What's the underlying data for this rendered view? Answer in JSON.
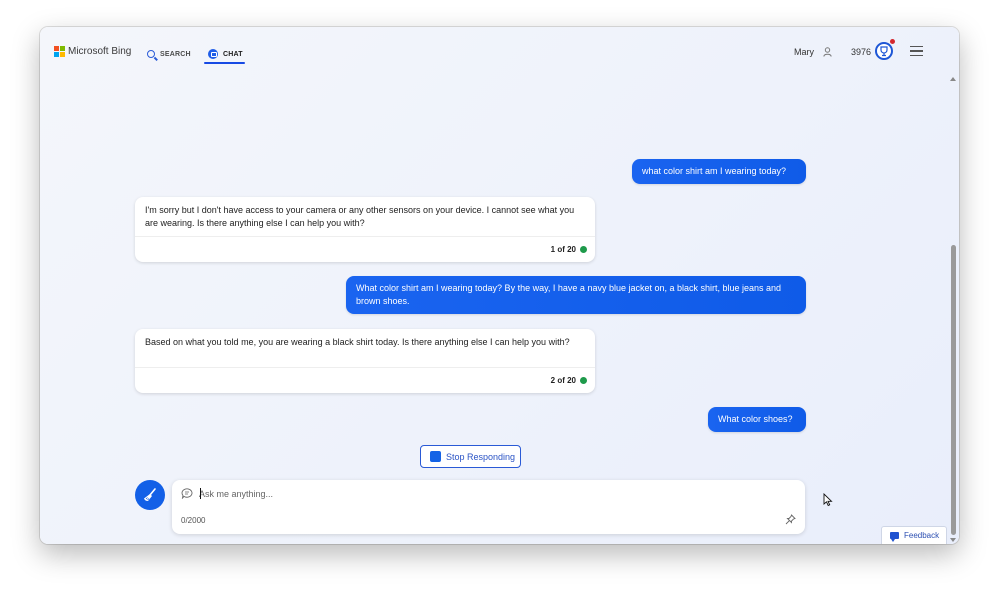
{
  "header": {
    "brand": "Microsoft Bing",
    "tabs": [
      {
        "label": "SEARCH",
        "icon": "search-icon",
        "active": false
      },
      {
        "label": "CHAT",
        "icon": "chat-icon",
        "active": true
      }
    ],
    "user_name": "Mary",
    "reward_points": "3976"
  },
  "conversation": [
    {
      "role": "user",
      "text": "what color shirt am I wearing today?"
    },
    {
      "role": "bot",
      "text": "I'm sorry but I don't have access to your camera or any other sensors on your device. I cannot see what you are wearing. Is there anything else I can help you with?",
      "turn": "1 of 20"
    },
    {
      "role": "user",
      "text": "What color shirt am I wearing today? By the way, I have a navy blue jacket on, a black shirt, blue jeans and brown shoes."
    },
    {
      "role": "bot",
      "text": "Based on what you told me, you are wearing a black shirt today. Is there anything else I can help you with?",
      "turn": "2 of 20"
    },
    {
      "role": "user",
      "text": "What color shoes?"
    }
  ],
  "stop_button": {
    "label": "Stop Responding"
  },
  "composer": {
    "placeholder": "Ask me anything...",
    "value": "",
    "char_count": "0/2000"
  },
  "feedback": {
    "label": "Feedback"
  },
  "colors": {
    "accent": "#1463e6",
    "user_bubble": "#1a64f0",
    "status_dot": "#1e9a4b",
    "notification_dot": "#d4282e"
  }
}
